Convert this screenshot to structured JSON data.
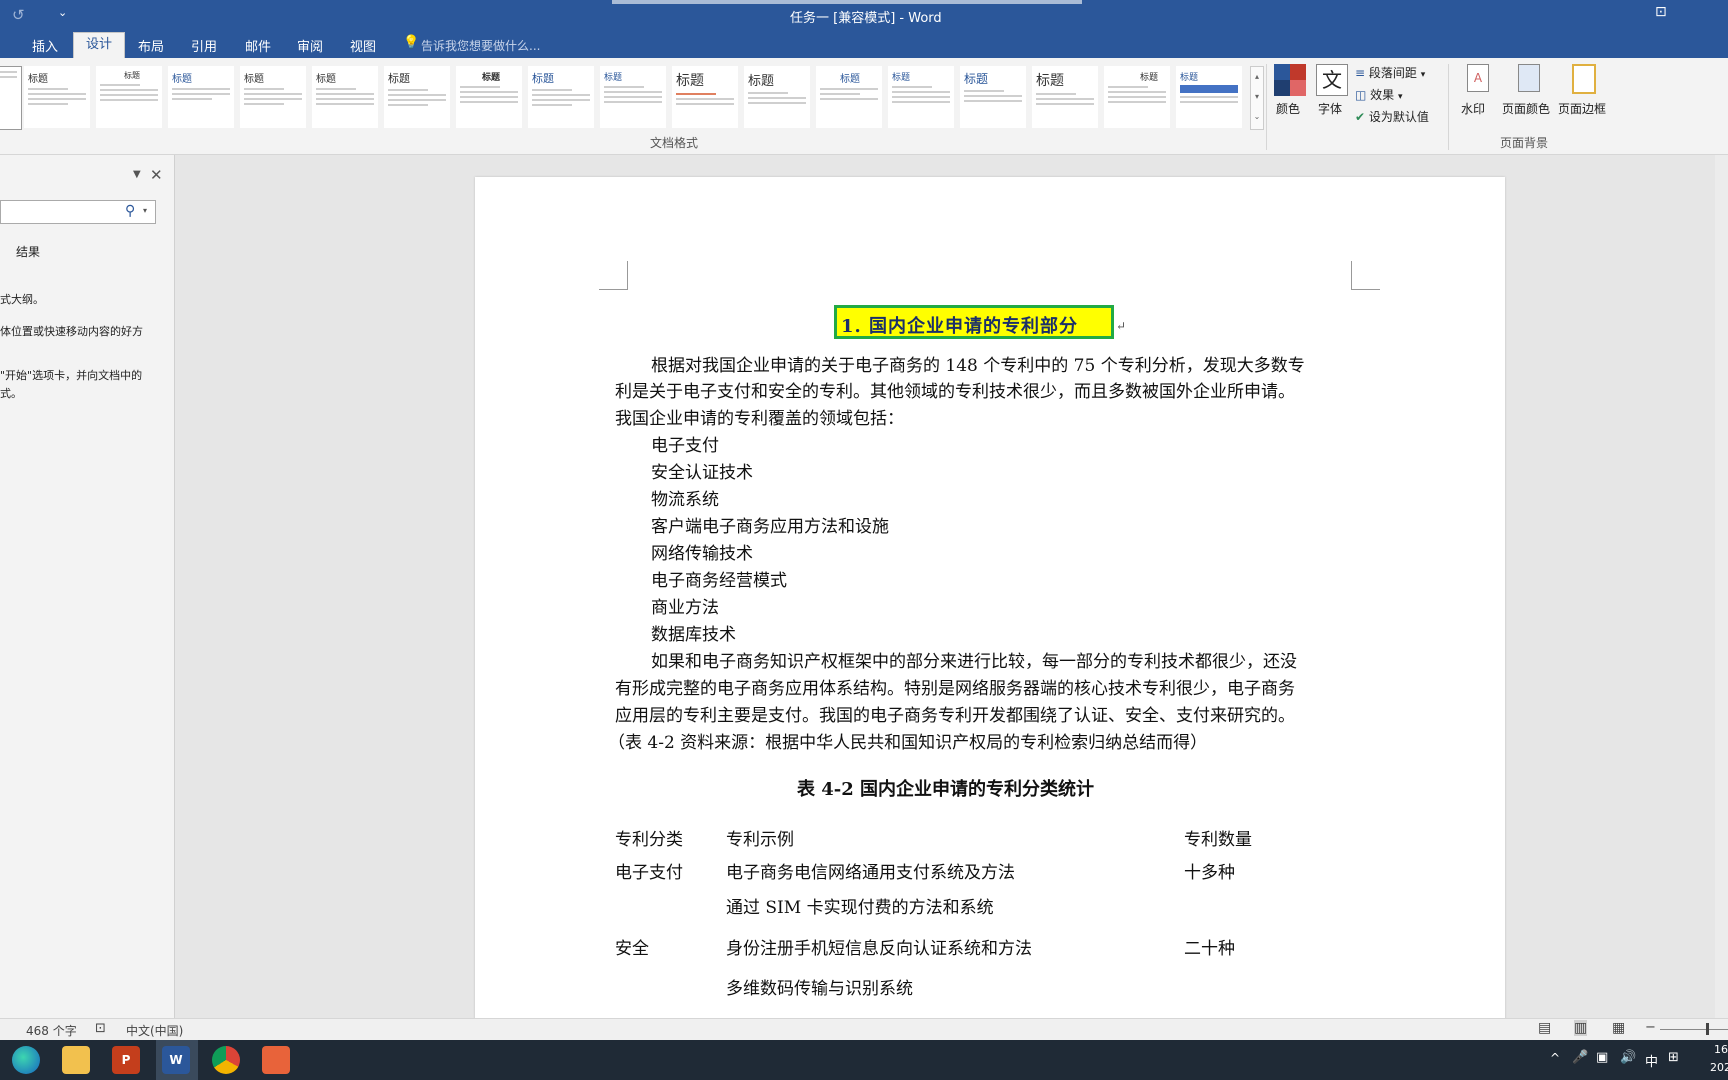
{
  "window": {
    "title": "任务一 [兼容模式] - Word"
  },
  "tabs": [
    {
      "label": "插入"
    },
    {
      "label": "设计"
    },
    {
      "label": "布局"
    },
    {
      "label": "引用"
    },
    {
      "label": "邮件"
    },
    {
      "label": "审阅"
    },
    {
      "label": "视图"
    }
  ],
  "tell_me": "告诉我您想要做什么...",
  "ribbon": {
    "style_thumbs": [
      "标题",
      "标题",
      "标题",
      "标题",
      "标题",
      "标题",
      "标题",
      "标题",
      "标题",
      "标题",
      "标题",
      "标题",
      "标题",
      "标题",
      "标题",
      "标题",
      "标题"
    ],
    "group_document_format": "文档格式",
    "colors_label": "颜色",
    "fonts_label": "字体",
    "fonts_glyph": "文",
    "paragraph_spacing": "段落间距",
    "effects": "效果",
    "set_default": "设为默认值",
    "watermark": "水印",
    "page_color": "页面颜色",
    "page_border": "页面边框",
    "group_page_background": "页面背景"
  },
  "nav": {
    "tab_results": "结果",
    "line1": "式大纲。",
    "line2": "体位置或快速移动内容的好方",
    "line3": "\"开始\"选项卡，并向文档中的",
    "line4": "式。"
  },
  "document": {
    "heading": "1. 国内企业申请的专利部分",
    "para1_l1": "根据对我国企业申请的关于电子商务的 148 个专利中的 75 个专利分析，发现大多数专",
    "para1_l2": "利是关于电子支付和安全的专利。其他领域的专利技术很少，而且多数被国外企业所申请。",
    "para1_l3": "我国企业申请的专利覆盖的领域包括：",
    "list": [
      "电子支付",
      "安全认证技术",
      "物流系统",
      "客户端电子商务应用方法和设施",
      "网络传输技术",
      "电子商务经营模式",
      "商业方法",
      "数据库技术"
    ],
    "para2_l1": "如果和电子商务知识产权框架中的部分来进行比较，每一部分的专利技术都很少，还没",
    "para2_l2": "有形成完整的电子商务应用体系结构。特别是网络服务器端的核心技术专利很少，电子商务",
    "para2_l3": "应用层的专利主要是支付。我国的电子商务专利开发都围绕了认证、安全、支付来研究的。",
    "para2_l4": "（表 4-2 资料来源：根据中华人民共和国知识产权局的专利检索归纳总结而得）",
    "table_title": "表 4-2 国内企业申请的专利分类统计",
    "table": {
      "headers": [
        "专利分类",
        "专利示例",
        "专利数量"
      ],
      "rows": [
        [
          "电子支付",
          "电子商务电信网络通用支付系统及方法",
          "十多种"
        ],
        [
          "",
          "通过 SIM 卡实现付费的方法和系统",
          ""
        ],
        [
          "安全",
          "身份注册手机短信息反向认证系统和方法",
          "二十种"
        ],
        [
          "",
          "多维数码传输与识别系统",
          ""
        ]
      ]
    },
    "mark": "↵"
  },
  "status": {
    "word_count": "468 个字",
    "language": "中文(中国)"
  },
  "tray": {
    "ime": "中",
    "clock_top": "16",
    "clock_bottom": "202"
  },
  "colors": {
    "word_blue": "#2b579a",
    "highlight_yellow": "#ffff00",
    "box_green": "#22aa44"
  }
}
